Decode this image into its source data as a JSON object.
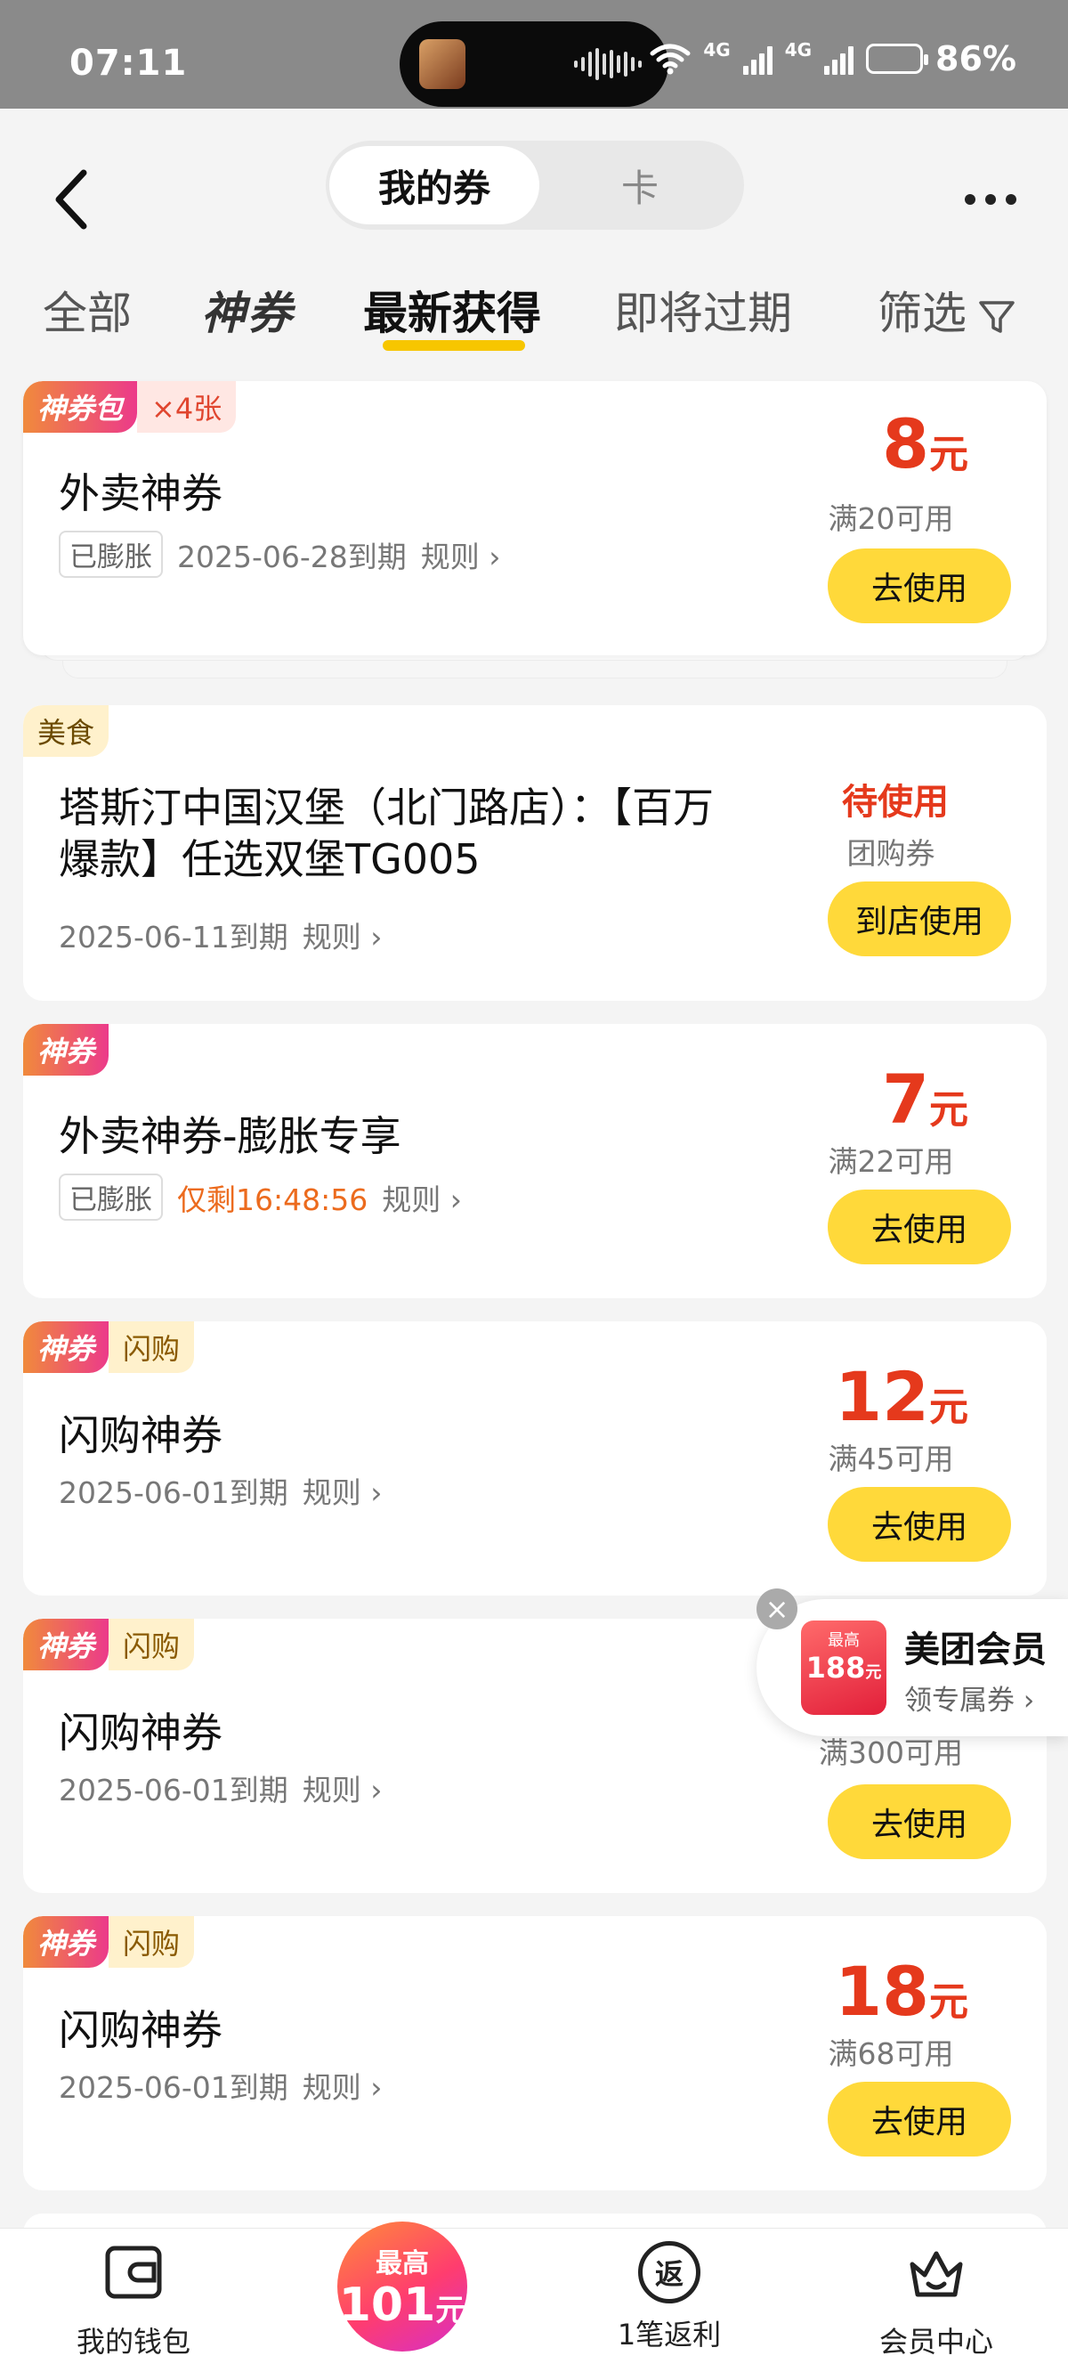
{
  "status_bar": {
    "time": "07:11",
    "battery": "86%",
    "network": "4G"
  },
  "header": {
    "segments": [
      "我的券",
      "卡"
    ],
    "tabs": [
      "全部",
      "神券",
      "最新获得",
      "即将过期",
      "筛选"
    ]
  },
  "coupons": [
    {
      "tags": [
        "神券包",
        "×4张"
      ],
      "title": "外卖神券",
      "badge": "已膨胀",
      "expiry": "2025-06-28到期",
      "rule": "规则",
      "amount": "8",
      "unit": "元",
      "condition": "满20可用",
      "action": "去使用"
    },
    {
      "tags": [
        "美食"
      ],
      "title_line1": "塔斯汀中国汉堡（北门路店）：【百万",
      "title_line2": "爆款】任选双堡TG005",
      "expiry": "2025-06-11到期",
      "rule": "规则",
      "status": "待使用",
      "type": "团购券",
      "action": "到店使用"
    },
    {
      "tags": [
        "神券"
      ],
      "title": "外卖神券-膨胀专享",
      "badge": "已膨胀",
      "countdown": "仅剩16:48:56",
      "rule": "规则",
      "amount": "7",
      "unit": "元",
      "condition": "满22可用",
      "action": "去使用"
    },
    {
      "tags": [
        "神券",
        "闪购"
      ],
      "title": "闪购神券",
      "expiry": "2025-06-01到期",
      "rule": "规则",
      "amount": "12",
      "unit": "元",
      "condition": "满45可用",
      "action": "去使用"
    },
    {
      "tags": [
        "神券",
        "闪购"
      ],
      "title": "闪购神券",
      "expiry": "2025-06-01到期",
      "rule": "规则",
      "condition": "满300可用",
      "action": "去使用"
    },
    {
      "tags": [
        "神券",
        "闪购"
      ],
      "title": "闪购神券",
      "expiry": "2025-06-01到期",
      "rule": "规则",
      "amount": "18",
      "unit": "元",
      "condition": "满68可用",
      "action": "去使用"
    }
  ],
  "floating_member": {
    "badge_top": "最高",
    "badge_amount": "188",
    "badge_unit": "元",
    "title": "美团会员",
    "subtitle": "领专属券"
  },
  "bottom_nav": {
    "wallet": "我的钱包",
    "center_top": "最高",
    "center_amount": "101",
    "center_unit": "元",
    "rebate_icon": "返",
    "rebate": "1笔返利",
    "member": "会员中心"
  },
  "colors": {
    "accent_yellow": "#ffd93a",
    "price_red": "#e5391c",
    "tab_underline": "#f7c600"
  }
}
